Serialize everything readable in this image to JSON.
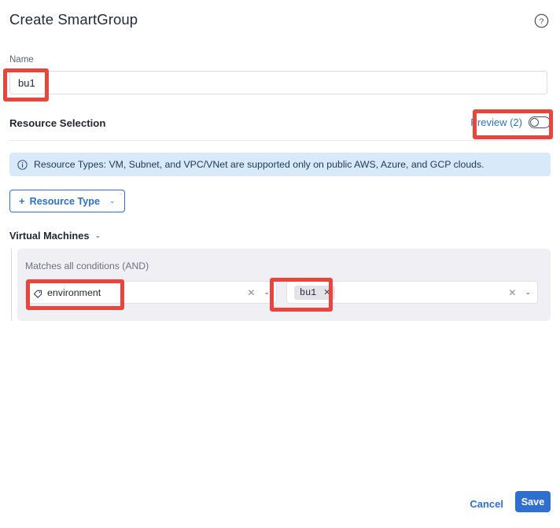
{
  "header": {
    "title": "Create SmartGroup",
    "help_icon": "question-circle-icon"
  },
  "name_field": {
    "label": "Name",
    "value": "bu1",
    "placeholder": ""
  },
  "resource_selection": {
    "title": "Resource Selection",
    "preview_label": "Preview (2)",
    "toggle_state": "off"
  },
  "info_banner": {
    "icon": "info-circle-icon",
    "text": "Resource Types: VM, Subnet, and VPC/VNet are supported only on public AWS, Azure, and GCP clouds."
  },
  "resource_type_button": {
    "plus": "+",
    "label": "Resource Type",
    "caret": "⌄"
  },
  "resource_group": {
    "title": "Virtual Machines",
    "caret": "⌄",
    "matches_label": "Matches all conditions (AND)",
    "conditions": [
      {
        "key_icon": "tag-icon",
        "key": "environment",
        "key_clear": "✕",
        "key_chevron": "⌄",
        "value_chip": "bu1",
        "value_chip_remove": "✕",
        "value_clear": "✕",
        "value_chevron": "⌄"
      }
    ]
  },
  "footer": {
    "cancel_label": "Cancel",
    "save_label": "Save"
  },
  "colors": {
    "accent_blue": "#2f6fd0",
    "info_banner_bg": "#d8e9f9",
    "panel_bg": "#f0f0f4",
    "annotation_red": "#e8453c",
    "chip_bg": "#e3e3e9"
  }
}
